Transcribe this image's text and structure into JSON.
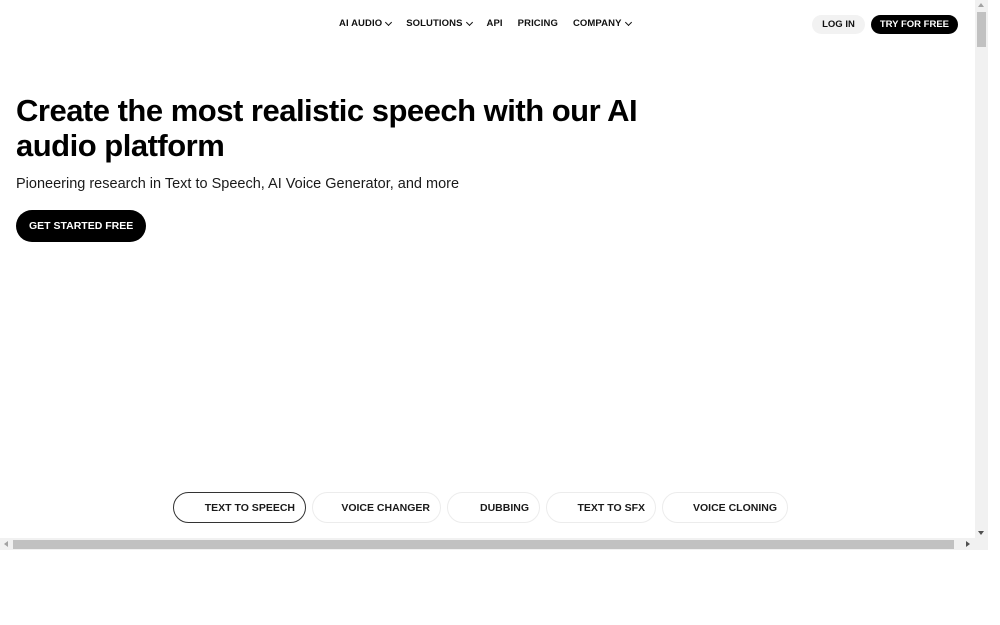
{
  "nav": {
    "items": [
      {
        "label": "AI AUDIO",
        "has_dropdown": true
      },
      {
        "label": "SOLUTIONS",
        "has_dropdown": true
      },
      {
        "label": "API",
        "has_dropdown": false
      },
      {
        "label": "PRICING",
        "has_dropdown": false
      },
      {
        "label": "COMPANY",
        "has_dropdown": true
      }
    ],
    "login_label": "LOG IN",
    "try_label": "TRY FOR FREE"
  },
  "hero": {
    "title": "Create the most realistic speech with our AI audio platform",
    "subtitle": "Pioneering research in Text to Speech, AI Voice Generator, and more",
    "cta_label": "GET STARTED FREE"
  },
  "tabs": [
    {
      "label": "TEXT TO SPEECH",
      "active": true
    },
    {
      "label": "VOICE CHANGER",
      "active": false
    },
    {
      "label": "DUBBING",
      "active": false
    },
    {
      "label": "TEXT TO SFX",
      "active": false
    },
    {
      "label": "VOICE CLONING",
      "active": false
    }
  ],
  "colors": {
    "primary": "#000000",
    "background": "#ffffff",
    "login_bg": "#f2f2f2"
  }
}
